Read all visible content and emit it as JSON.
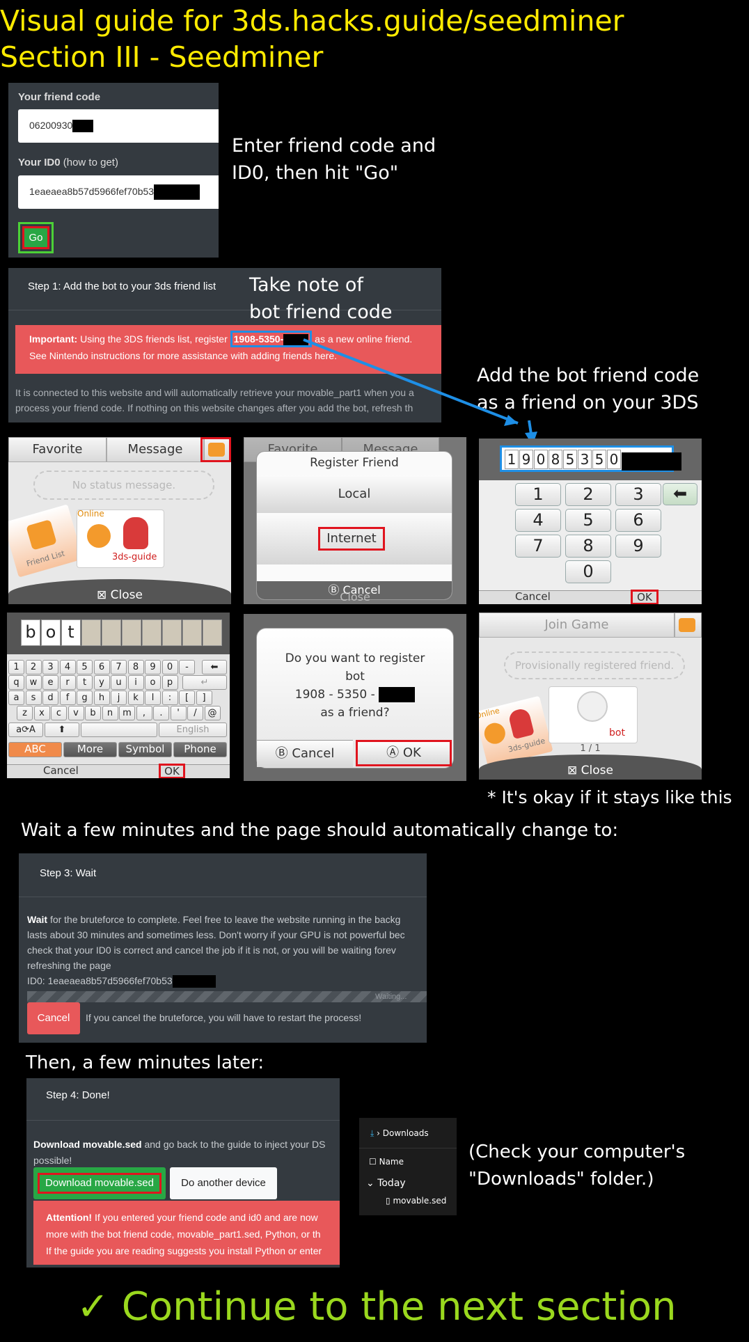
{
  "title_lines": [
    "Visual guide for 3ds.hacks.guide/seedminer",
    "Section III - Seedminer"
  ],
  "form": {
    "friend_code_label": "Your friend code",
    "friend_code_value": "06200930",
    "id0_label": "Your ID0",
    "id0_hint": "(how to get)",
    "id0_value": "1eaeaea8b57d5966fef70b53",
    "go_label": "Go"
  },
  "notes": {
    "enter": [
      "Enter friend code and",
      "ID0, then hit \"Go\""
    ],
    "take_note": [
      "Take note of",
      "bot friend code"
    ],
    "add_bot": [
      "Add the bot friend code",
      "as a friend on your 3DS"
    ],
    "okay": "* It's okay if it stays like this",
    "wait": "Wait a few minutes and the page should automatically change to:",
    "then": "Then, a few minutes later:",
    "check_downloads": [
      "(Check your computer's",
      "\"Downloads\" folder.)"
    ]
  },
  "step1": {
    "header": "Step 1: Add the bot to your 3ds friend list",
    "important_label": "Important:",
    "important_text": "Using the 3DS friends list, register",
    "bot_code": "1908-5350-",
    "important_text2": "as a new online friend.",
    "important_line2": "See Nintendo instructions for more assistance with adding friends here.",
    "info_line1": "It is connected to this website and will automatically retrieve your movable_part1 when you a",
    "info_line2": "process your friend code. If nothing on this website changes after you add the bot, refresh th"
  },
  "ds_friend": {
    "tab_favorite": "Favorite",
    "tab_message": "Message",
    "status_placeholder": "No status message.",
    "online_label": "Online",
    "card_name": "3ds-guide",
    "friend_list_label": "Friend List",
    "close_label": "Close"
  },
  "ds_register": {
    "title": "Register Friend",
    "option_local": "Local",
    "option_internet": "Internet",
    "cancel_label": "Cancel",
    "close_label": "Close",
    "tab_favorite": "Favorite",
    "tab_message": "Message"
  },
  "ds_keypad": {
    "digits": [
      "1",
      "9",
      "0",
      "8",
      "5",
      "3",
      "5",
      "0"
    ],
    "keys": [
      "1",
      "2",
      "3",
      "4",
      "5",
      "6",
      "7",
      "8",
      "9",
      "0"
    ],
    "cancel_label": "Cancel",
    "ok_label": "OK"
  },
  "ds_keyboard": {
    "name_chars": [
      "b",
      "o",
      "t"
    ],
    "row1": [
      "1",
      "2",
      "3",
      "4",
      "5",
      "6",
      "7",
      "8",
      "9",
      "0",
      "-"
    ],
    "row2": [
      "q",
      "w",
      "e",
      "r",
      "t",
      "y",
      "u",
      "i",
      "o",
      "p"
    ],
    "row3": [
      "a",
      "s",
      "d",
      "f",
      "g",
      "h",
      "j",
      "k",
      "l",
      ":",
      "[",
      "]"
    ],
    "row4": [
      "z",
      "x",
      "c",
      "v",
      "b",
      "n",
      "m",
      ",",
      ".",
      "'",
      "/",
      "@"
    ],
    "lang_label": "English",
    "modes": [
      "ABC",
      "More",
      "Symbol",
      "Phone"
    ],
    "cancel_label": "Cancel",
    "ok_label": "OK"
  },
  "ds_confirm": {
    "line1": "Do you want to register",
    "line2": "bot",
    "line3": "1908 - 5350 -",
    "line4": "as a friend?",
    "cancel_label": "Cancel",
    "ok_label": "OK"
  },
  "ds_join": {
    "tab_join": "Join Game",
    "status_placeholder": "Provisionally registered friend.",
    "online_label": "Online",
    "card_name": "3ds-guide",
    "bot_name": "bot",
    "page": "1  /  1",
    "close_label": "Close"
  },
  "step3": {
    "header": "Step 3: Wait",
    "wait_bold": "Wait",
    "line1": "for the bruteforce to complete. Feel free to leave the website running in the backg",
    "line2": "lasts about 30 minutes and sometimes less. Don't worry if your GPU is not powerful bec",
    "line3": "check that your ID0 is correct and cancel the job if it is not, or you will be waiting forev",
    "line4": "refreshing the page",
    "id0_label": "ID0: 1eaeaea8b57d5966fef70b53",
    "progress_text": "Waiting...",
    "cancel_label": "Cancel",
    "cancel_note": "If you cancel the bruteforce, you will have to restart the process!"
  },
  "step4": {
    "header": "Step 4: Done!",
    "download_bold": "Download movable.sed",
    "line1": "and go back to the guide to inject your DS",
    "line2": "possible!",
    "download_button": "Download movable.sed",
    "another_button": "Do another device",
    "attention_label": "Attention!",
    "attention1": "If you entered your friend code and id0 and are now",
    "attention2": "more with the bot friend code, movable_part1.sed, Python, or th",
    "attention3": "If the guide you are reading suggests you install Python or enter"
  },
  "explorer": {
    "breadcrumb": "Downloads",
    "col_name": "Name",
    "group_today": "Today",
    "file_name": "movable.sed"
  },
  "footer": {
    "text": "Continue to the next section"
  },
  "colors": {
    "title_yellow": "#ffeb00",
    "footer_green": "#9ad81e",
    "highlight_red": "#e0141e",
    "highlight_blue": "#1e8fe6",
    "panel_dark": "#343a40"
  }
}
